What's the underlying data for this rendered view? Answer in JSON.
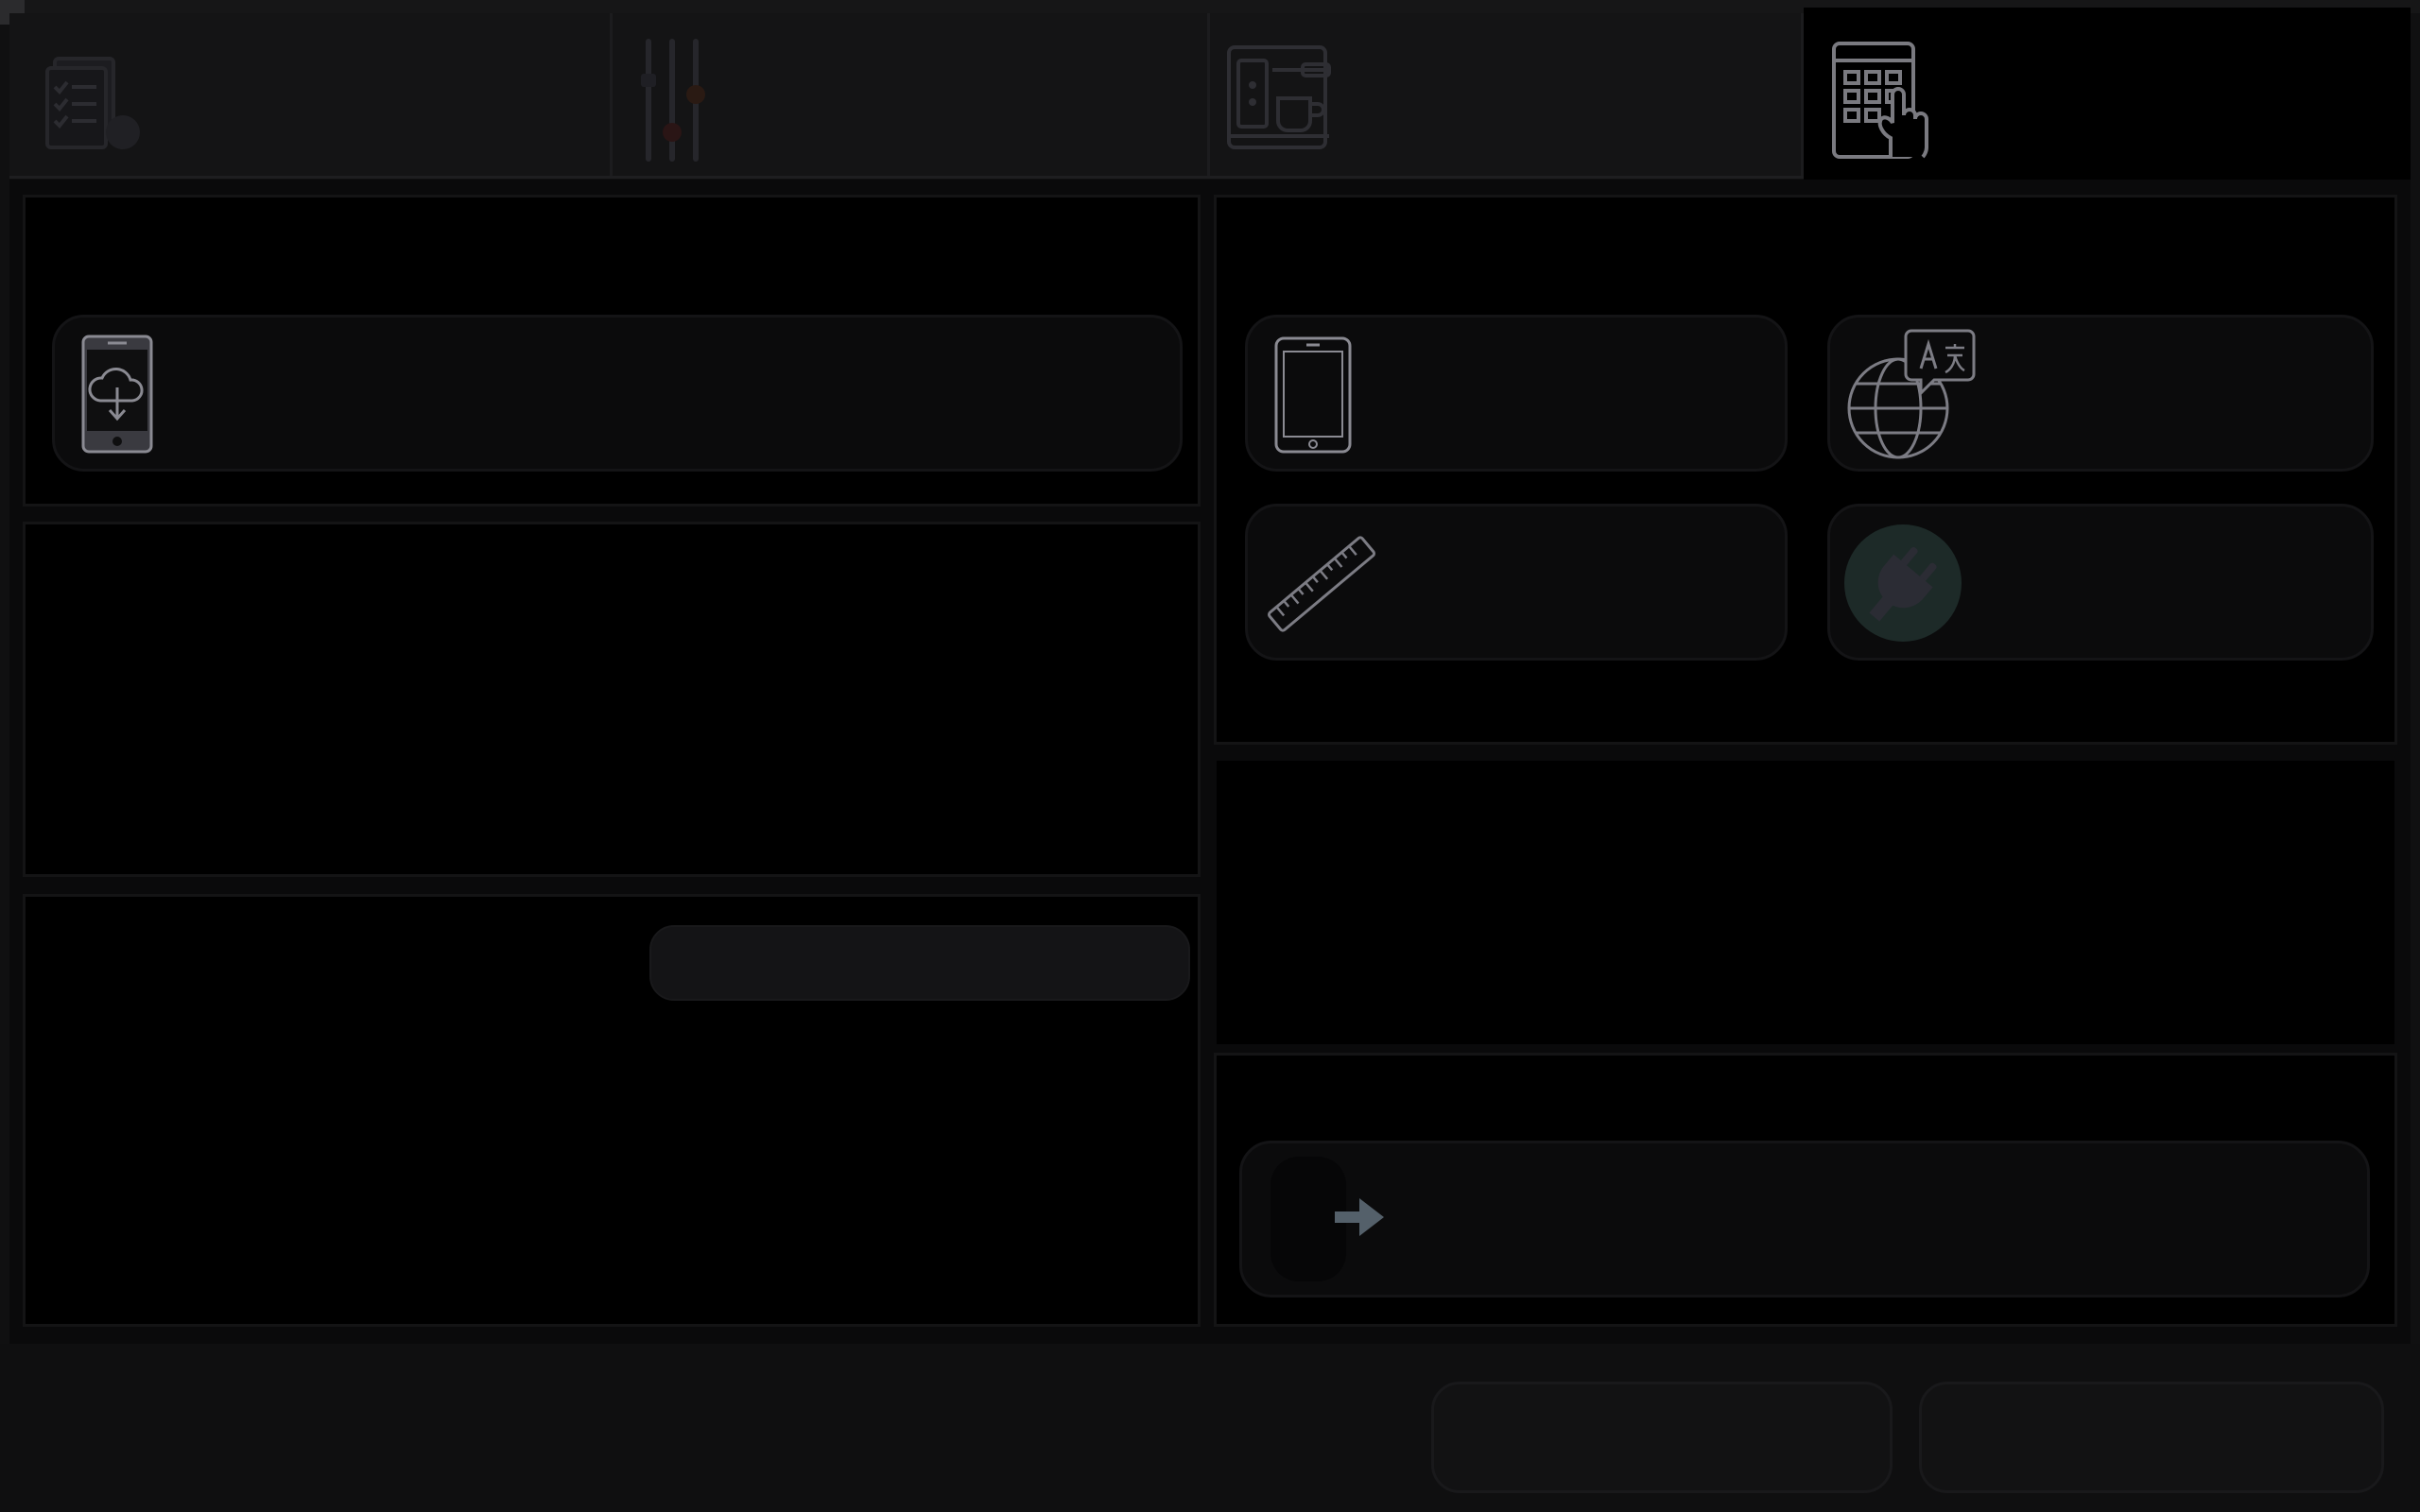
{
  "tabs": [
    {
      "icon": "checklist-document-icon"
    },
    {
      "icon": "equalizer-sliders-icon"
    },
    {
      "icon": "coffee-machine-icon"
    },
    {
      "icon": "touch-keypad-icon",
      "active": true
    }
  ],
  "left_panel": {
    "cards": [
      {
        "icon": "phone-cloud-download-icon",
        "label": ""
      }
    ],
    "input": {
      "value": ""
    }
  },
  "right_panel": {
    "cards": [
      {
        "icon": "tablet-icon",
        "label": ""
      },
      {
        "icon": "globe-translate-icon",
        "label": ""
      },
      {
        "icon": "ruler-icon",
        "label": ""
      },
      {
        "icon": "power-plug-icon",
        "label": ""
      }
    ],
    "logout_card": {
      "icon": "exit-arrow-icon",
      "label": ""
    }
  },
  "footer": {
    "button_1_label": "",
    "button_2_label": ""
  },
  "colors": {
    "background": "#101011",
    "panel": "#000000",
    "card": "#0b0b0c",
    "icon_stroke": "#7e7e84",
    "plug_circle": "#1d2a28",
    "arrow": "#54606a"
  }
}
